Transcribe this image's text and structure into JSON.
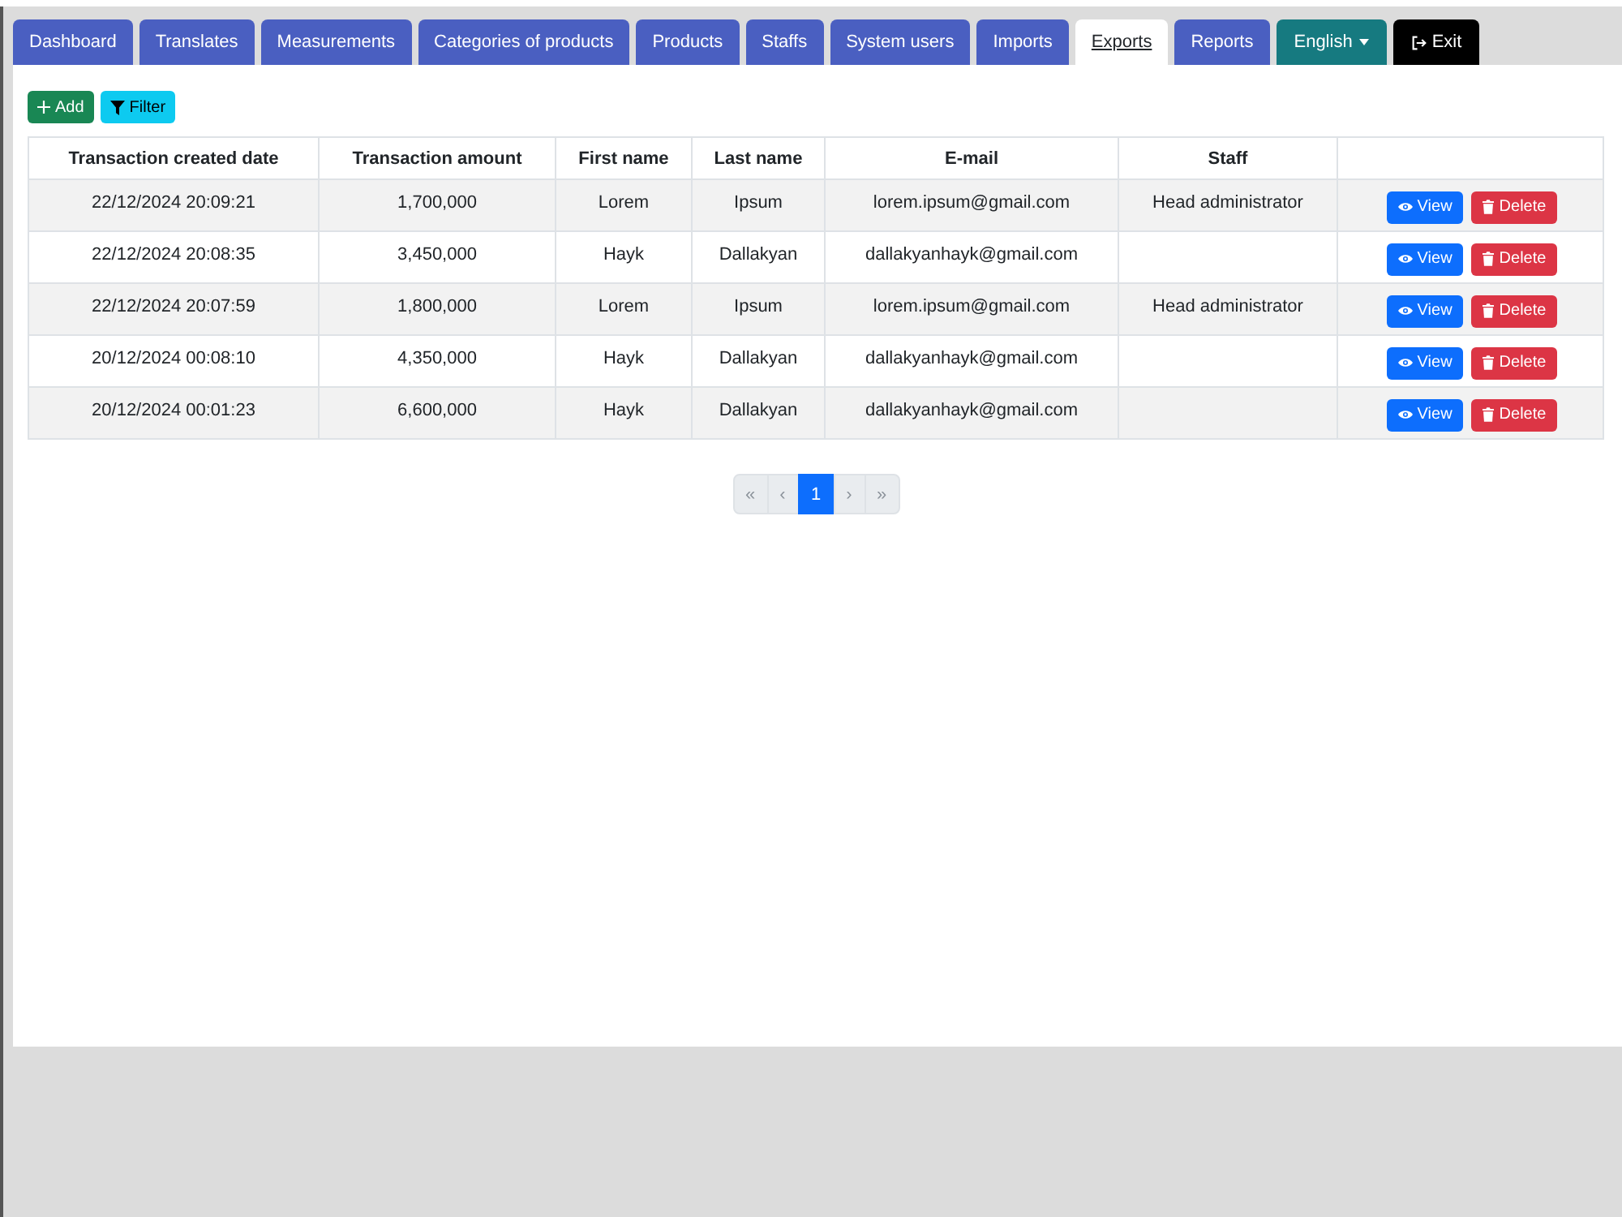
{
  "tabs": [
    {
      "kind": "tab",
      "label": "Dashboard",
      "selected": false
    },
    {
      "kind": "tab",
      "label": "Translates",
      "selected": false
    },
    {
      "kind": "tab",
      "label": "Measurements",
      "selected": false
    },
    {
      "kind": "tab",
      "label": "Categories of products",
      "selected": false
    },
    {
      "kind": "tab",
      "label": "Products",
      "selected": false
    },
    {
      "kind": "tab",
      "label": "Staffs",
      "selected": false
    },
    {
      "kind": "tab",
      "label": "System users",
      "selected": false
    },
    {
      "kind": "tab",
      "label": "Imports",
      "selected": false
    },
    {
      "kind": "tab",
      "label": "Exports",
      "selected": true
    },
    {
      "kind": "tab",
      "label": "Reports",
      "selected": false
    },
    {
      "kind": "dropdown",
      "label": "English",
      "selected": false
    },
    {
      "kind": "exit",
      "label": "Exit",
      "selected": false
    }
  ],
  "toolbar": [
    {
      "kind": "add",
      "label": "Add"
    },
    {
      "kind": "filter",
      "label": "Filter"
    }
  ],
  "table": {
    "columns": [
      "Transaction created date",
      "Transaction amount",
      "First name",
      "Last name",
      "E-mail",
      "Staff"
    ],
    "rows": [
      {
        "date": "22/12/2024 20:09:21",
        "amount": "1,700,000",
        "first_name": "Lorem",
        "last_name": "Ipsum",
        "email": "lorem.ipsum@gmail.com",
        "staff": "Head administrator",
        "actions": [
          {
            "kind": "view",
            "label": "View"
          },
          {
            "kind": "delete",
            "label": "Delete"
          }
        ]
      },
      {
        "date": "22/12/2024 20:08:35",
        "amount": "3,450,000",
        "first_name": "Hayk",
        "last_name": "Dallakyan",
        "email": "dallakyanhayk@gmail.com",
        "actions": [
          {
            "kind": "view",
            "label": "View"
          },
          {
            "kind": "delete",
            "label": "Delete"
          }
        ]
      },
      {
        "date": "22/12/2024 20:07:59",
        "amount": "1,800,000",
        "first_name": "Lorem",
        "last_name": "Ipsum",
        "email": "lorem.ipsum@gmail.com",
        "staff": "Head administrator",
        "actions": [
          {
            "kind": "view",
            "label": "View"
          },
          {
            "kind": "delete",
            "label": "Delete"
          }
        ]
      },
      {
        "date": "20/12/2024 00:08:10",
        "amount": "4,350,000",
        "first_name": "Hayk",
        "last_name": "Dallakyan",
        "email": "dallakyanhayk@gmail.com",
        "actions": [
          {
            "kind": "view",
            "label": "View"
          },
          {
            "kind": "delete",
            "label": "Delete"
          }
        ]
      },
      {
        "date": "20/12/2024 00:01:23",
        "amount": "6,600,000",
        "first_name": "Hayk",
        "last_name": "Dallakyan",
        "email": "dallakyanhayk@gmail.com",
        "actions": [
          {
            "kind": "view",
            "label": "View"
          },
          {
            "kind": "delete",
            "label": "Delete"
          }
        ]
      }
    ]
  },
  "pagination": [
    {
      "kind": "first",
      "label": "«",
      "selected": false,
      "disabled": true
    },
    {
      "kind": "previous",
      "label": "‹",
      "selected": false,
      "disabled": true
    },
    {
      "kind": "page",
      "label": "1",
      "selected": true,
      "disabled": false
    },
    {
      "kind": "next",
      "label": "›",
      "selected": false,
      "disabled": true
    },
    {
      "kind": "last",
      "label": "»",
      "selected": false,
      "disabled": true
    }
  ]
}
